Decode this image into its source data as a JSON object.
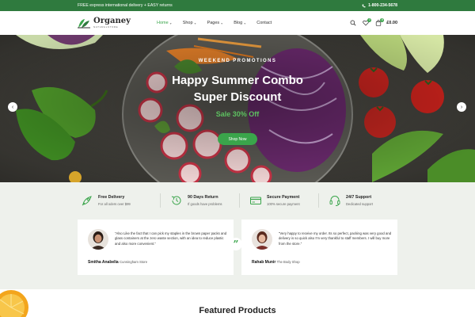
{
  "topbar": {
    "promo": "FREE express international delivery + EASY returns",
    "phone": "1-800-234-5678"
  },
  "header": {
    "logo_name": "Organey",
    "logo_sub": "NATURALSTORE",
    "nav": [
      {
        "label": "Home",
        "has_dropdown": true,
        "active": true
      },
      {
        "label": "Shop",
        "has_dropdown": true
      },
      {
        "label": "Pages",
        "has_dropdown": true
      },
      {
        "label": "Blog",
        "has_dropdown": true
      },
      {
        "label": "Contact",
        "has_dropdown": false
      }
    ],
    "wishlist_count": "0",
    "cart_count": "0",
    "cart_total": "£0.00"
  },
  "hero": {
    "tag": "WEEKEND PROMOTIONS",
    "title_line1": "Happy Summer Combo",
    "title_line2": "Super Discount",
    "sale": "Sale 30% Off",
    "button": "Shop Now",
    "prev_icon": "chevron-left-icon",
    "next_icon": "chevron-right-icon"
  },
  "features": [
    {
      "icon": "rocket-icon",
      "title": "Free Delivery",
      "subtitle": "For all oders over $99"
    },
    {
      "icon": "return-icon",
      "title": "90 Days Return",
      "subtitle": "If goods have problems"
    },
    {
      "icon": "card-icon",
      "title": "Secure Payment",
      "subtitle": "100% secure payment"
    },
    {
      "icon": "headset-icon",
      "title": "24/7 Support",
      "subtitle": "Dedicated support"
    }
  ],
  "testimonials": [
    {
      "quote": "“Also Like the fact that I can pick my staples in the brown paper packs and glass containers at the zero waste section, with an idea to reduce plastic and also more convenient.”",
      "name": "Smitha Anabelia",
      "company": "Cunningham Store"
    },
    {
      "quote": "“Very happy to receive my order. Its so perfect, packing was very good and delivery is so quick also I'm very thankful to staff members. I will buy more from the store.”",
      "name": "Rahab Munir",
      "company": "The Body Shop"
    }
  ],
  "featured": {
    "title": "Featured Products"
  },
  "colors": {
    "brand_green": "#3aa54b",
    "topbar_green": "#2f7a3e",
    "section_bg": "#eef1ec"
  }
}
